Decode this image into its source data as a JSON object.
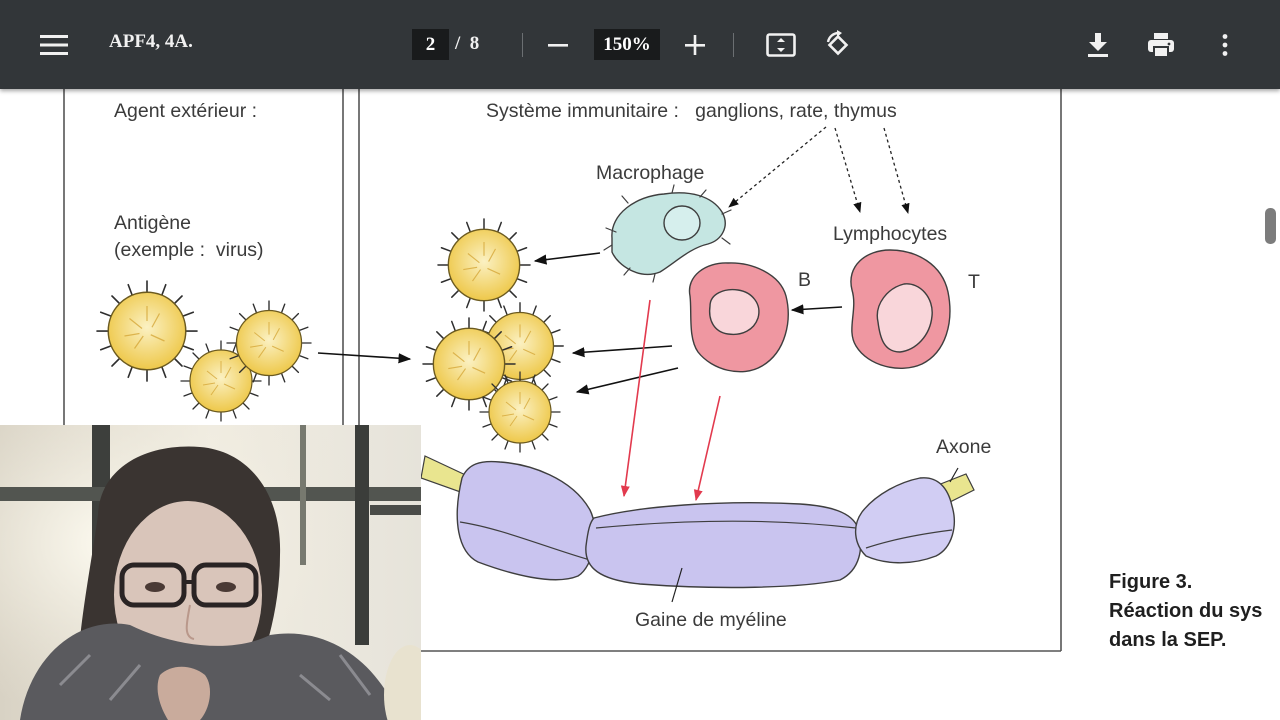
{
  "viewer": {
    "title": "APF4, 4A.",
    "current_page": "2",
    "page_separator": "/",
    "total_pages": "8",
    "zoom": "150%"
  },
  "icons": {
    "menu": "menu-icon",
    "zoom_out": "minus-icon",
    "zoom_in": "plus-icon",
    "fit_page": "fit-page-icon",
    "rotate": "rotate-icon",
    "download": "download-icon",
    "print": "print-icon",
    "more": "more-vert-icon"
  },
  "figure": {
    "agent_label": "Agent extérieur :",
    "immune_label": "Système immunitaire :   ganglions, rate, thymus",
    "antigen_label_1": "Antigène",
    "antigen_label_2": "(exemple :  virus)",
    "macrophage_label": "Macrophage",
    "lymphocytes_label": "Lymphocytes",
    "b_label": "B",
    "t_label": "T",
    "axone_label": "Axone",
    "myelin_label": "Gaine de myéline"
  },
  "caption": {
    "line1": "Figure 3.",
    "line2": "Réaction du sys",
    "line3": "dans la SEP."
  },
  "colors": {
    "toolbar_bg": "#323639",
    "virus_yellow": "#f2d35a",
    "macrophage_teal": "#bfe3e0",
    "lymphocyte_pink": "#ee8f9a",
    "myelin_lavender": "#c9c4ef",
    "red_arrow": "#e23a4e"
  }
}
